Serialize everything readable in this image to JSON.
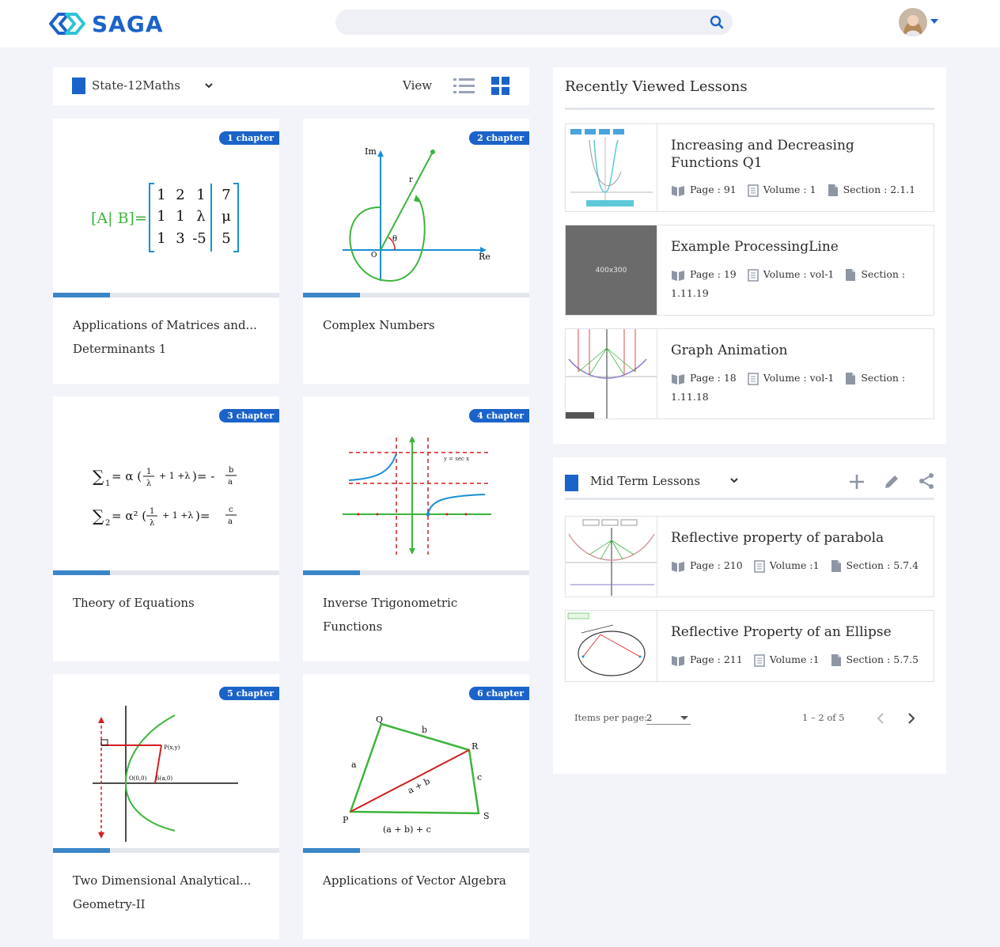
{
  "header": {
    "logo_text": "SAGA",
    "search_placeholder": ""
  },
  "toolbar": {
    "subject": "State-12Maths",
    "view_label": "View"
  },
  "cards": [
    {
      "badge": "1 chapter",
      "title": "Applications of Matrices and... Determinants 1",
      "progress": 0.25
    },
    {
      "badge": "2 chapter",
      "title": "Complex Numbers",
      "progress": 0.25
    },
    {
      "badge": "3 chapter",
      "title": "Theory of Equations",
      "progress": 0.25
    },
    {
      "badge": "4 chapter",
      "title": "Inverse Trigonometric Functions",
      "progress": 0.25
    },
    {
      "badge": "5 chapter",
      "title": "Two Dimensional Analytical... Geometry-II",
      "progress": 0.25
    },
    {
      "badge": "6 chapter",
      "title": "Applications of Vector Algebra",
      "progress": 0.25
    }
  ],
  "card_art": {
    "matrix_lhs": "[A| B]=",
    "matrix_rows": [
      [
        "1",
        "2",
        "1",
        "7"
      ],
      [
        "1",
        "1",
        "λ",
        "μ"
      ],
      [
        "1",
        "3",
        "-5",
        "5"
      ]
    ],
    "complex_labels": {
      "im": "Im",
      "re": "Re",
      "r": "r",
      "theta": "θ",
      "origin": "O"
    },
    "sec_label": "y = sec x",
    "parabola_labels": {
      "p": "P(x,y)",
      "o": "O(0,0)",
      "s": "S(a,0)"
    },
    "vector_labels": {
      "q": "Q",
      "r": "R",
      "p": "P",
      "s": "S",
      "a": "a",
      "b": "b",
      "c": "c",
      "ab": "a + b",
      "sum": "(a + b) + c"
    }
  },
  "recent": {
    "title": "Recently Viewed Lessons",
    "lessons": [
      {
        "title": "Increasing and Decreasing Functions Q1",
        "page": "Page : 91",
        "volume": "Volume : 1",
        "section": "Section : 2.1.1"
      },
      {
        "title": "Example ProcessingLine",
        "page": "Page : 19",
        "volume": "Volume : vol-1",
        "section": "Section :",
        "section_cont": "1.11.19",
        "thumb_text": "400x300"
      },
      {
        "title": "Graph Animation",
        "page": "Page : 18",
        "volume": "Volume : vol-1",
        "section": "Section :",
        "section_cont": "1.11.18"
      }
    ]
  },
  "midterm": {
    "title": "Mid Term Lessons",
    "lessons": [
      {
        "title": "Reflective property of parabola",
        "page": "Page : 210",
        "volume": "Volume :1",
        "section": "Section : 5.7.4"
      },
      {
        "title": "Reflective Property of an Ellipse",
        "page": "Page : 211",
        "volume": "Volume :1",
        "section": "Section : 5.7.5"
      }
    ],
    "pager": {
      "label": "Items per page:",
      "per_page": "2",
      "range": "1 – 2 of 5"
    }
  },
  "colors": {
    "brand": "#1b63c9",
    "progress": "#3a86c8",
    "green": "#3db53d",
    "red": "#d11f1f"
  }
}
